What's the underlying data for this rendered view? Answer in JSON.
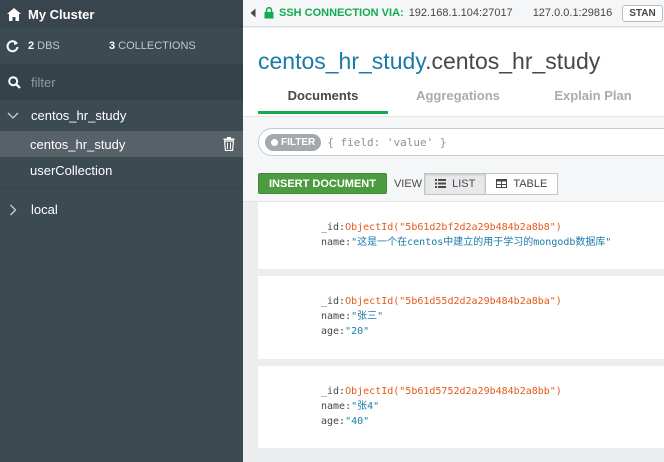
{
  "sidebar": {
    "cluster_name": "My Cluster",
    "dbs_count": "2",
    "dbs_label": "DBS",
    "collections_count": "3",
    "collections_label": "COLLECTIONS",
    "filter_placeholder": "filter",
    "databases": [
      {
        "name": "centos_hr_study",
        "expanded": true,
        "collections": [
          "centos_hr_study",
          "userCollection"
        ]
      },
      {
        "name": "local",
        "expanded": false
      }
    ]
  },
  "topbar": {
    "ssh_label": "SSH CONNECTION VIA:",
    "ssh_host": "192.168.1.104:27017",
    "local_host": "127.0.0.1:29816",
    "mode_badge": "STAN"
  },
  "namespace": {
    "db": "centos_hr_study",
    "collection": ".centos_hr_study"
  },
  "tabs": [
    {
      "label": "Documents",
      "active": true
    },
    {
      "label": "Aggregations",
      "active": false
    },
    {
      "label": "Explain Plan",
      "active": false
    }
  ],
  "query": {
    "filter_button": "FILTER",
    "filter_placeholder": "{ field: 'value' }"
  },
  "actions": {
    "insert_label": "INSERT DOCUMENT",
    "view_label": "VIEW",
    "list_label": "LIST",
    "table_label": "TABLE"
  },
  "documents": [
    {
      "id_key": "_id:",
      "id_value": "ObjectId(\"5b61d2bf2d2a29b484b2a8b8\")",
      "fields": [
        {
          "key": "name:",
          "value": "\"这是一个在centos中建立的用于学习的mongodb数据库\""
        }
      ]
    },
    {
      "id_key": "_id:",
      "id_value": "ObjectId(\"5b61d55d2d2a29b484b2a8ba\")",
      "fields": [
        {
          "key": "name:",
          "value": "\"张三\""
        },
        {
          "key": "age:",
          "value": "\"20\""
        }
      ]
    },
    {
      "id_key": "_id:",
      "id_value": "ObjectId(\"5b61d5752d2a29b484b2a8bb\")",
      "fields": [
        {
          "key": "name:",
          "value": "\"张4\""
        },
        {
          "key": "age:",
          "value": "\"40\""
        }
      ]
    }
  ],
  "colors": {
    "sidebar_bg": "#3c4a52",
    "accent_green": "#13aa52",
    "namespace_blue": "#1b7aaa",
    "objectid_orange": "#e4591b"
  }
}
